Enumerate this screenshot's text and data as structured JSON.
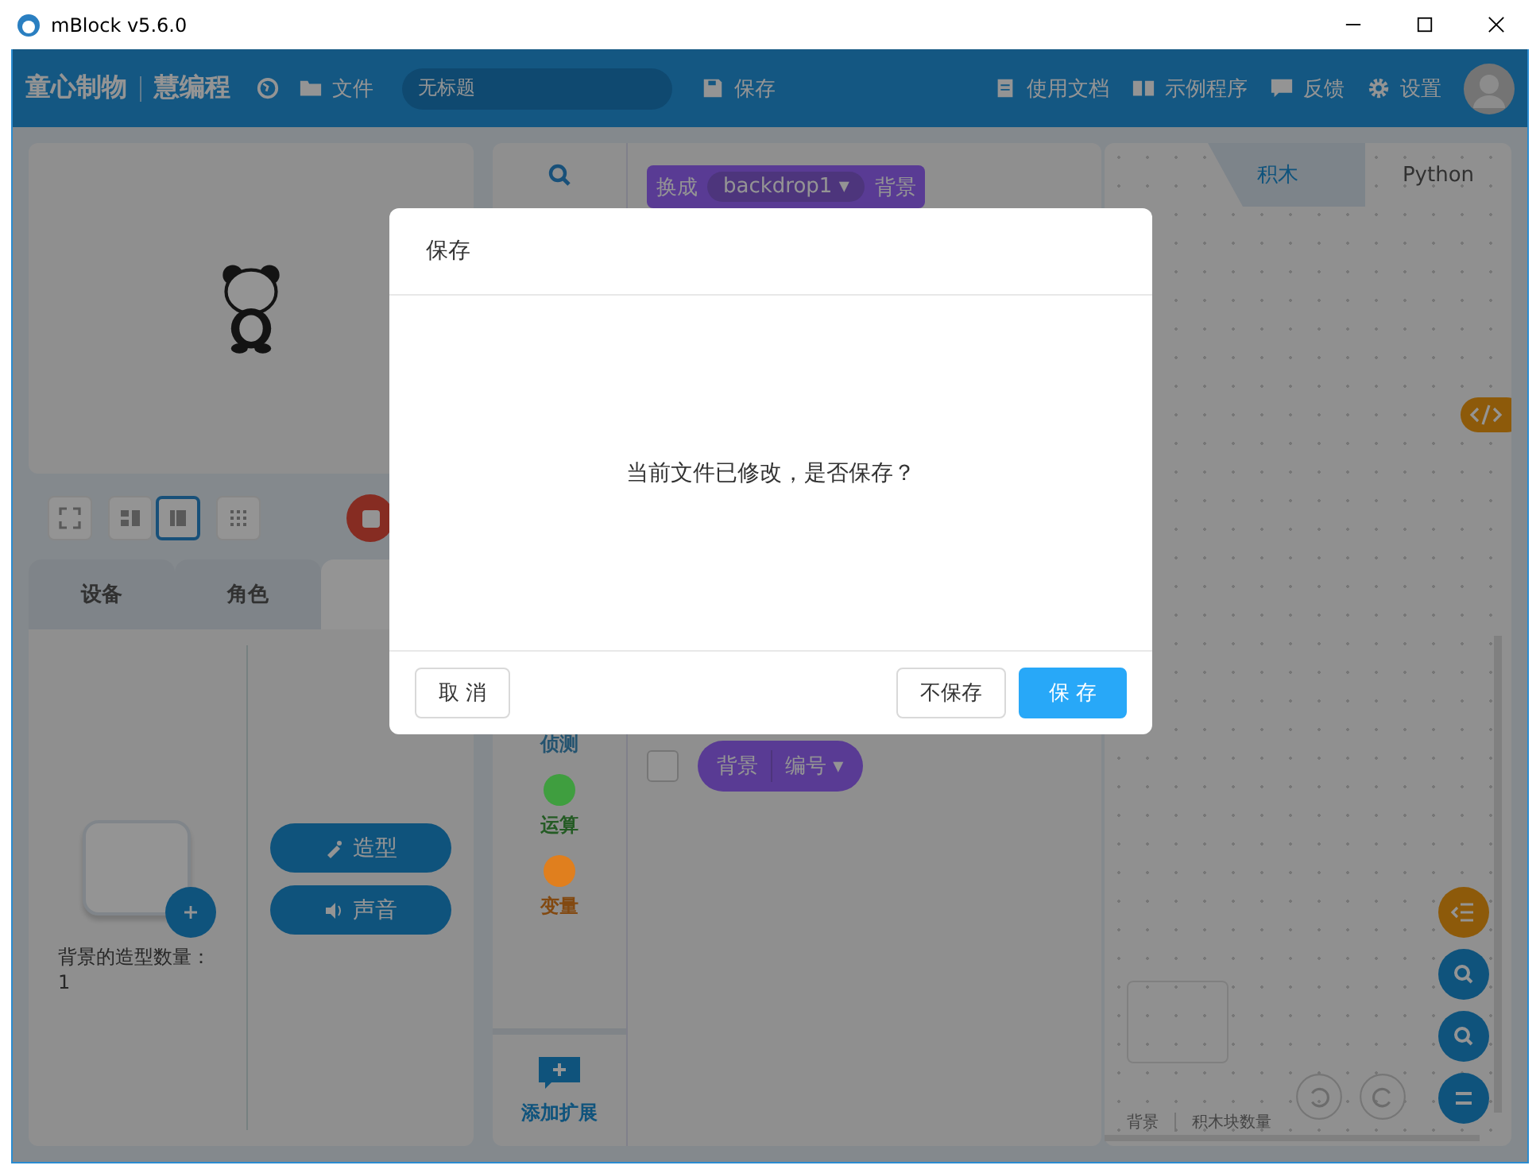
{
  "window": {
    "title": "mBlock v5.6.0"
  },
  "header": {
    "brand": "童心制物",
    "product": "慧编程",
    "file_menu": "文件",
    "project_name": "无标题",
    "save": "保存",
    "links": [
      {
        "kind": "docs",
        "label": "使用文档"
      },
      {
        "kind": "examples",
        "label": "示例程序"
      },
      {
        "kind": "feedback",
        "label": "反馈"
      },
      {
        "kind": "settings",
        "label": "设置"
      }
    ]
  },
  "view_modes": [
    {
      "kind": "fullscreen",
      "selected": false
    },
    {
      "kind": "small",
      "selected": false
    },
    {
      "kind": "large",
      "selected": true
    },
    {
      "kind": "grid",
      "selected": false
    }
  ],
  "left_tabs": [
    {
      "label": "设备",
      "selected": false
    },
    {
      "label": "角色",
      "selected": false
    },
    {
      "selected": true
    }
  ],
  "backdrop_panel": {
    "count_text": "背景的造型数量：1",
    "buttons": [
      {
        "kind": "costume",
        "label": "造型"
      },
      {
        "kind": "sound",
        "label": "声音"
      }
    ]
  },
  "categories": [
    {
      "label": "侦测"
    },
    {
      "label": "运算",
      "color": "#3f9e3f"
    },
    {
      "label": "变量",
      "color": "#e07f1e"
    }
  ],
  "extension_button": "添加扩展",
  "switch_block": {
    "prefix": "换成",
    "dropdown": "backdrop1 ▾",
    "suffix": "背景"
  },
  "reporter": {
    "label": "背景",
    "dropdown": "编号 ▾",
    "checked": false
  },
  "code_tabs": [
    {
      "label": "积木",
      "selected": true
    },
    {
      "label": "Python",
      "selected": false
    }
  ],
  "status": {
    "target": "背景",
    "block_count_label": "积木块数量"
  },
  "dialog": {
    "title": "保存",
    "message": "当前文件已修改，是否保存？",
    "buttons": [
      {
        "label": "取 消",
        "kind": "default"
      },
      {
        "label": "不保存",
        "kind": "default"
      },
      {
        "label": "保 存",
        "kind": "primary"
      }
    ]
  }
}
